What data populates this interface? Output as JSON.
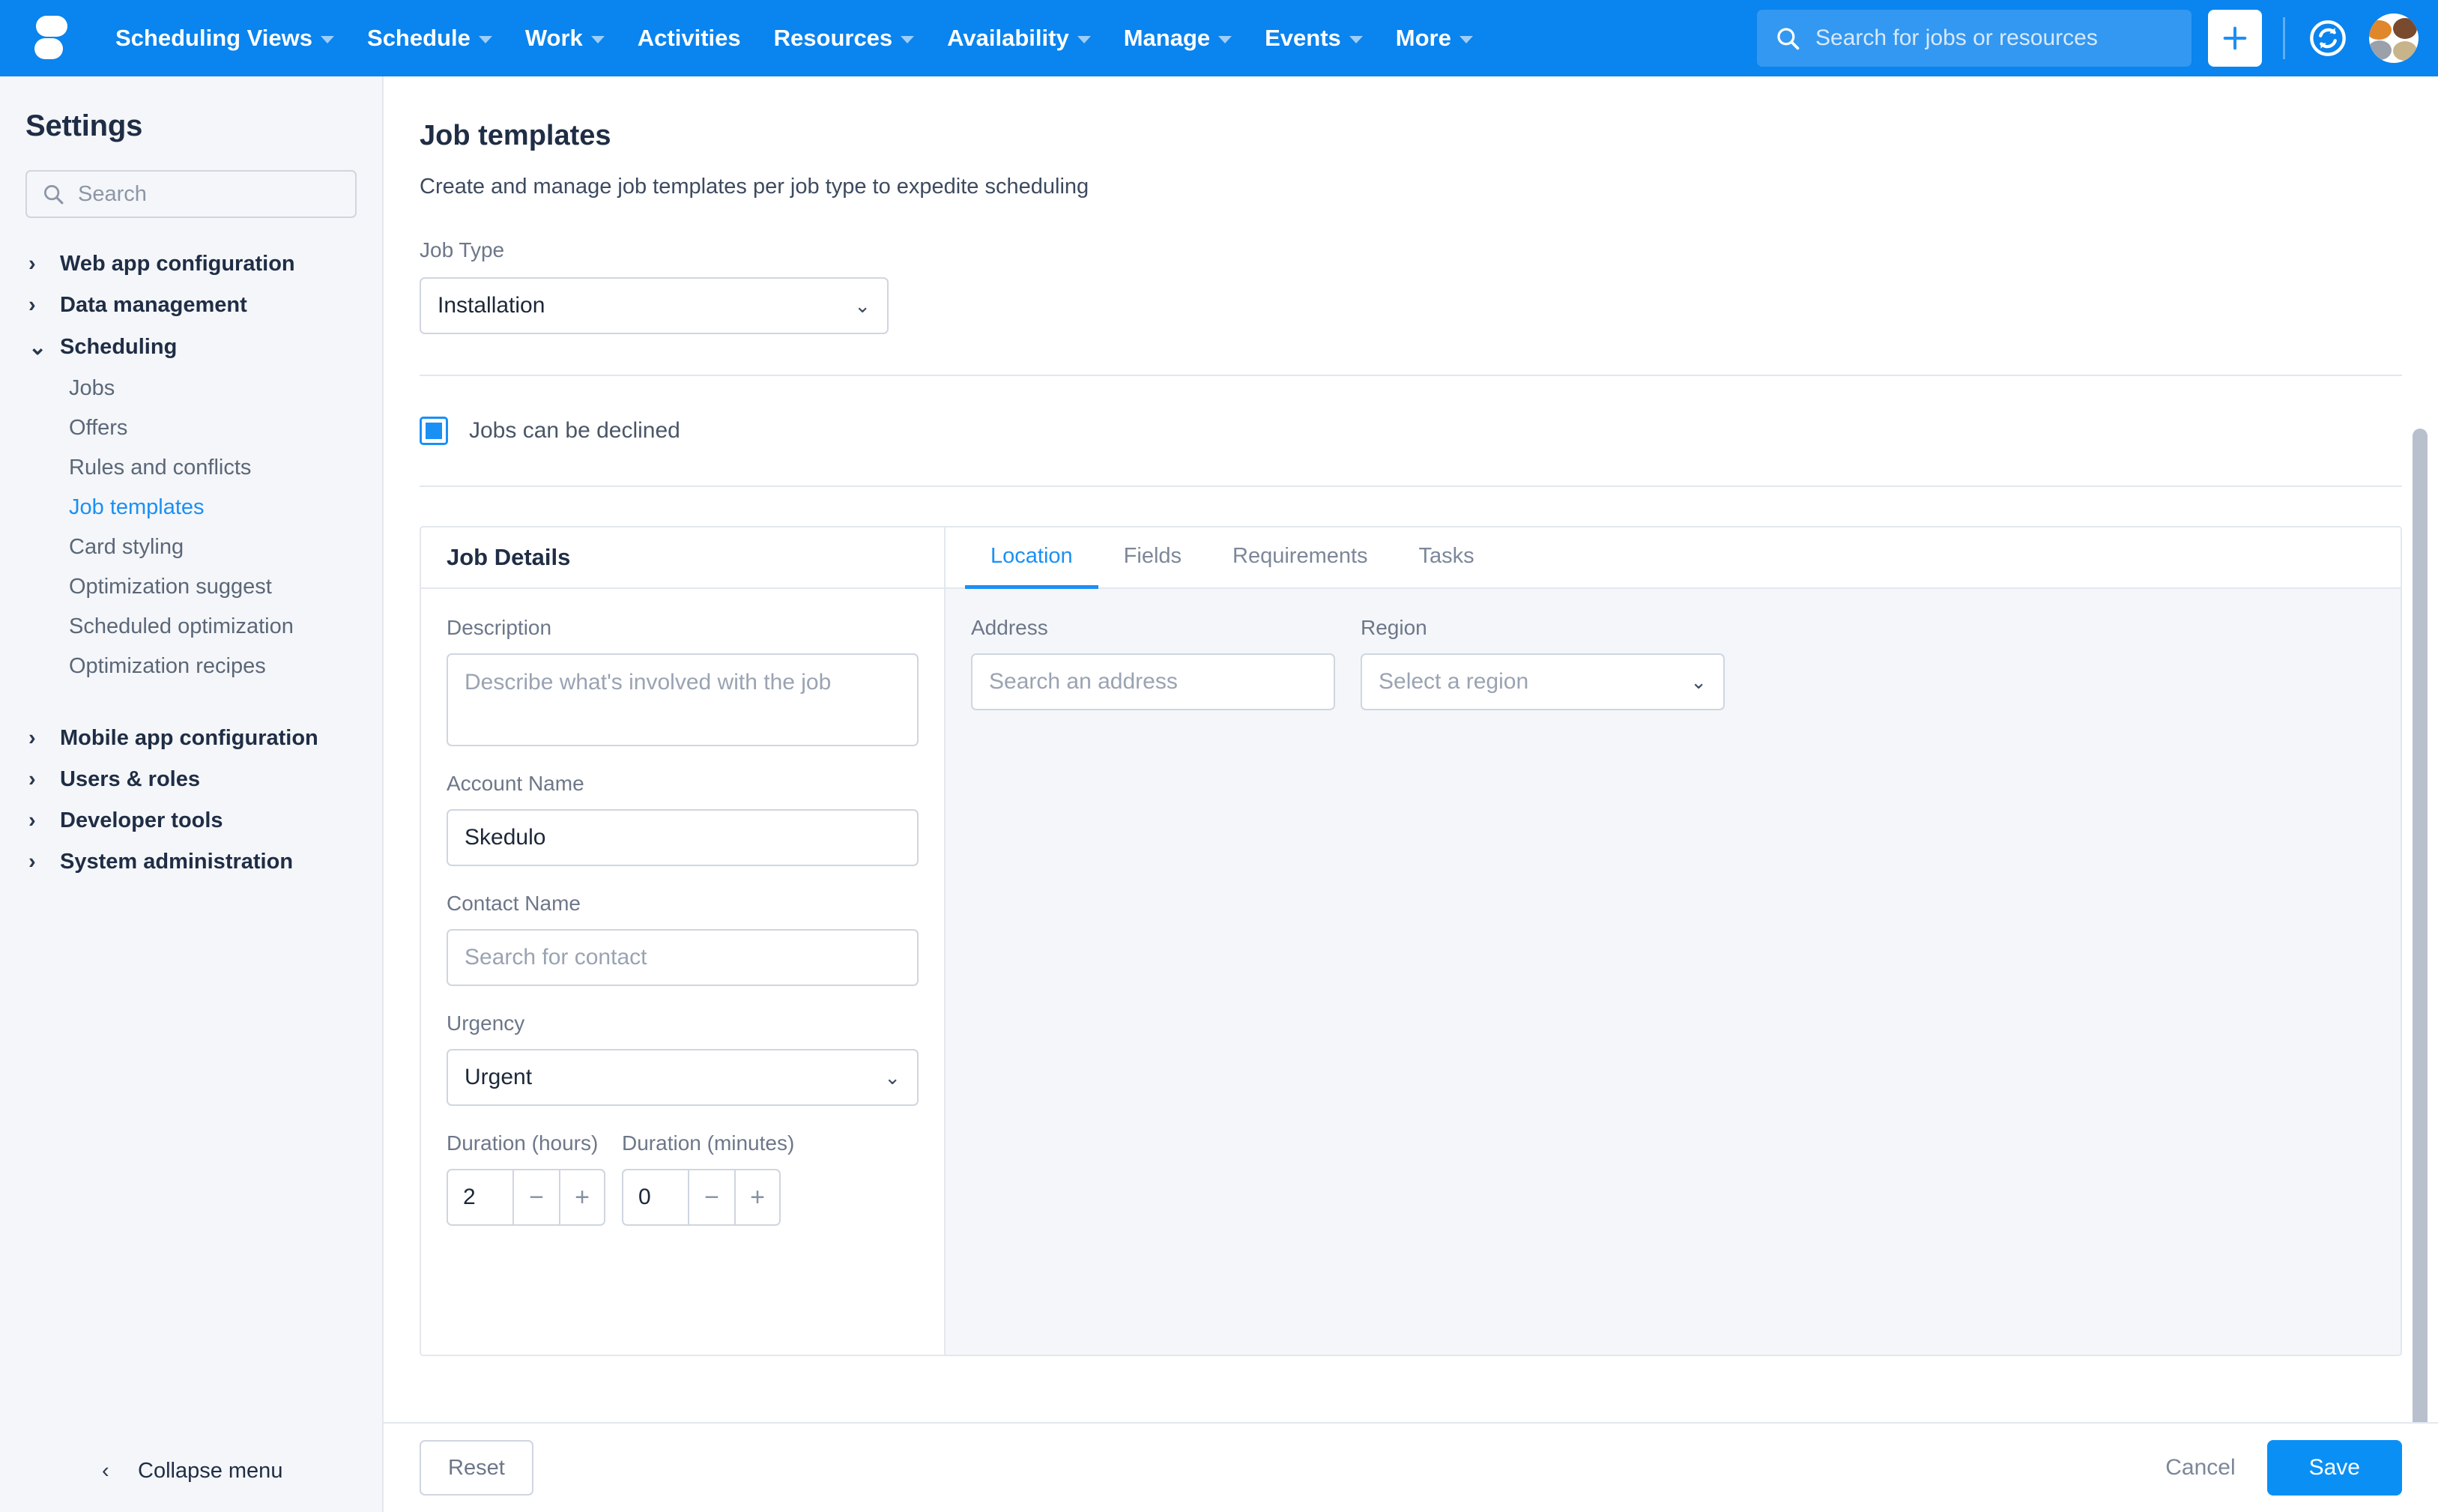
{
  "topnav": {
    "brand": "skedulo-logo",
    "items": [
      {
        "label": "Scheduling Views",
        "has_caret": true
      },
      {
        "label": "Schedule",
        "has_caret": true
      },
      {
        "label": "Work",
        "has_caret": true
      },
      {
        "label": "Activities",
        "has_caret": false
      },
      {
        "label": "Resources",
        "has_caret": true
      },
      {
        "label": "Availability",
        "has_caret": true
      },
      {
        "label": "Manage",
        "has_caret": true
      },
      {
        "label": "Events",
        "has_caret": true
      },
      {
        "label": "More",
        "has_caret": true
      }
    ],
    "search_placeholder": "Search for jobs or resources",
    "accent": "#0a84ee"
  },
  "sidebar": {
    "title": "Settings",
    "search_placeholder": "Search",
    "groups": [
      {
        "label": "Web app configuration",
        "expanded": false
      },
      {
        "label": "Data management",
        "expanded": false
      },
      {
        "label": "Scheduling",
        "expanded": true
      }
    ],
    "scheduling_children": [
      {
        "label": "Jobs",
        "active": false
      },
      {
        "label": "Offers",
        "active": false
      },
      {
        "label": "Rules and conflicts",
        "active": false
      },
      {
        "label": "Job templates",
        "active": true
      },
      {
        "label": "Card styling",
        "active": false
      },
      {
        "label": "Optimization suggest",
        "active": false
      },
      {
        "label": "Scheduled optimization",
        "active": false
      },
      {
        "label": "Optimization recipes",
        "active": false
      }
    ],
    "groups_lower": [
      {
        "label": "Mobile app configuration"
      },
      {
        "label": "Users & roles"
      },
      {
        "label": "Developer tools"
      },
      {
        "label": "System administration"
      }
    ],
    "collapse_label": "Collapse menu",
    "active_color": "#1a90f5"
  },
  "main": {
    "title": "Job templates",
    "subtitle": "Create and manage job templates per job type to expedite scheduling",
    "job_type_label": "Job Type",
    "job_type_value": "Installation",
    "declined_label": "Jobs can be declined",
    "declined_checked": true
  },
  "card": {
    "left_header": "Job Details",
    "description_label": "Description",
    "description_placeholder": "Describe what's involved with the job",
    "description_value": "",
    "account_label": "Account Name",
    "account_value": "Skedulo",
    "contact_label": "Contact Name",
    "contact_placeholder": "Search for contact",
    "contact_value": "",
    "urgency_label": "Urgency",
    "urgency_value": "Urgent",
    "duration_hours_label": "Duration (hours)",
    "duration_hours_value": "2",
    "duration_minutes_label": "Duration (minutes)",
    "duration_minutes_value": "0",
    "stepper_minus": "−",
    "stepper_plus": "+",
    "tabs": [
      {
        "label": "Location",
        "active": true
      },
      {
        "label": "Fields",
        "active": false
      },
      {
        "label": "Requirements",
        "active": false
      },
      {
        "label": "Tasks",
        "active": false
      }
    ],
    "address_label": "Address",
    "address_placeholder": "Search an address",
    "address_value": "",
    "region_label": "Region",
    "region_value": "Select a region"
  },
  "footer": {
    "reset_label": "Reset",
    "cancel_label": "Cancel",
    "save_label": "Save",
    "save_color": "#0a90f5"
  }
}
